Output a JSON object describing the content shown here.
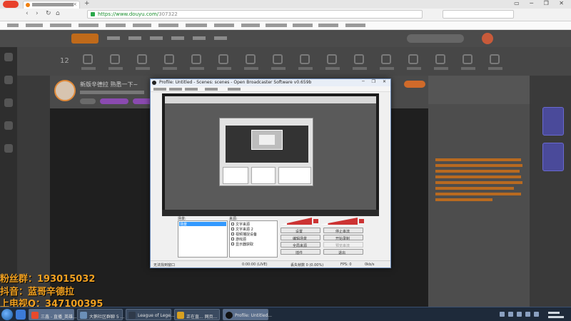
{
  "browser": {
    "url_host": "https://www.douyu.com/",
    "url_path": "307322",
    "window_controls": "▭ ─ ❐ ✕",
    "new_tab": "+",
    "tab_close": "×",
    "nav": {
      "back": "‹",
      "forward": "›",
      "reload": "↻",
      "home": "⌂"
    }
  },
  "category_bar": {
    "count": "12"
  },
  "room": {
    "title": "新版辛德拉 熟悉一下~"
  },
  "overlay": {
    "line1": "粉丝群：193015032",
    "line2": "抖音：蓝哥辛德拉",
    "line3": "上电视Q：347100395"
  },
  "obs": {
    "title": "Profile: Untitled - Scenes: scenes - Open Broadcaster Software v0.659b",
    "window_controls": "─ ❐ ✕",
    "scenes_label": "场景:",
    "sources_label": "来源:",
    "scenes": [
      "场景"
    ],
    "sources": [
      "文字来源",
      "文字来源 2",
      "视频捕捉设备",
      "游戏源",
      "显示器获取"
    ],
    "buttons": {
      "settings": "设置",
      "stop_stream": "停止串流",
      "edit_scene": "编辑场景",
      "start_recording": "开始录制",
      "global_sources": "全局来源",
      "preview_stream": "预览串流",
      "plugins": "插件",
      "exit": "退出"
    },
    "status": {
      "left": "无法找到窗口",
      "time": "0:00:00 (LIVE)",
      "dropped": "丢失帧数 0 (0.00%)",
      "fps": "FPS: 0",
      "bitrate": "0kb/s"
    }
  },
  "taskbar": {
    "tasks": [
      "三鑫 - 直播_英雄...",
      "大鹅社区群聊 5 ...",
      "League of Lege...",
      "正在直... 网页...",
      "Profile: Untitled..."
    ]
  },
  "colors": {
    "accent_orange": "#e08a3a",
    "overlay_text": "#f0a020",
    "obs_frame": "#6a8ab8",
    "taskbar": "#1e2a3a"
  },
  "icons": [
    "browser-logo-icon",
    "lock-icon",
    "obs-app-icon",
    "volume-icon",
    "start-orb-icon"
  ]
}
